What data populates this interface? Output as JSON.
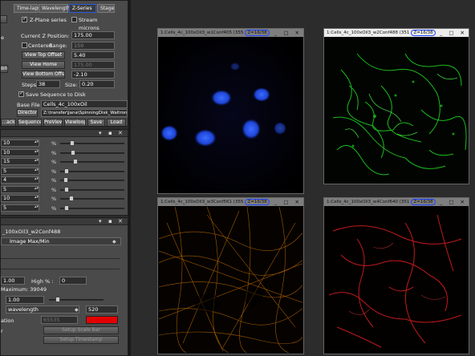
{
  "top_panel": {
    "tabs": [
      "Time-lapse",
      "Wavelength",
      "Z-Series",
      "Stage"
    ],
    "active_tab": "Z-Series",
    "z_plane_series": "Z-Plane series",
    "stream": "Stream",
    "units": "microns",
    "current_z_label": "Current Z Position:",
    "current_z_value": "175.00",
    "centered": "Centered",
    "range_label": "Range:",
    "range_value": "150",
    "view_top_offset": "View Top Offset",
    "top_offset_value": "5.40",
    "view_home": "View Home",
    "home_value": "175.00",
    "view_bottom_offset": "View Bottom Offset",
    "bottom_offset_value": "-2.10",
    "steps_label": "Steps:",
    "steps_value": "38",
    "size_label": "Size:",
    "size_value": "0.20",
    "save_sequence": "Save Sequence to Disk",
    "base_file_label": "Base File",
    "base_file_value": "Cells_4c_100xOil",
    "directory_button": "Directory",
    "directory_value": "Z:\\transfer\\Jana\\SpinningDisk_Waltron\\Ga",
    "bottom_buttons": [
      "...ack",
      "Sequence",
      "PreView",
      "Viewloop",
      "Save",
      "Load"
    ],
    "side_labels": [
      "e",
      "gon"
    ]
  },
  "mid_panel": {
    "rows": [
      {
        "value": "10",
        "unit": "%",
        "slider": 0.15
      },
      {
        "value": "10",
        "unit": "%",
        "slider": 0.16
      },
      {
        "value": "15",
        "unit": "%",
        "slider": 0.2
      },
      {
        "value": "5",
        "unit": "%",
        "slider": 0.06
      },
      {
        "value": "4",
        "unit": "%",
        "slider": 0.05
      },
      {
        "value": "5",
        "unit": "%",
        "slider": 0.06
      },
      {
        "value": "10",
        "unit": "%",
        "slider": 0.14
      },
      {
        "value": "5",
        "unit": "%",
        "slider": 0.06
      }
    ]
  },
  "bot_panel": {
    "name": "_100xOil3_w2Conf488",
    "mode": "Image Max/Min",
    "low_value": "1.00",
    "high_label": "High % :",
    "high_value": "0",
    "maximum": "Maximum: 39049",
    "gamma_value": "1.00",
    "wavelength_label": "wavelength",
    "wavelength_value": "520",
    "lut_label": "ation",
    "lut_color": "#e40000",
    "disabled_value": "65535",
    "setup_scale_bar": "Setup Scale Bar",
    "setup_timestamp": "Setup Timestamp",
    "side_label_r": "r"
  },
  "windows": [
    {
      "title": "1:Cells_4c_100xOil3_w1Conf405 (355",
      "z": "Z=16/38",
      "style": "dark",
      "channel": "blue"
    },
    {
      "title": "1:Cells_4c_100xOil3_w2Conf488 (351",
      "z": "Z=16/38",
      "style": "light",
      "channel": "green"
    },
    {
      "title": "1:Cells_4c_100xOil3_w3Conf561 (355",
      "z": "Z=16/38",
      "style": "dark",
      "channel": "orange"
    },
    {
      "title": "1:Cells_4c_100xOil3_w4Conf640 (351",
      "z": "Z=16/38",
      "style": "dark",
      "channel": "red"
    }
  ],
  "window_controls": "_ □ ✕",
  "colors": {
    "highlight_ellipse": "#2044ff",
    "blue_channel": "#1a4aff",
    "green_channel": "#1fcf1f",
    "orange_channel": "#d77800",
    "red_channel": "#e02020"
  }
}
